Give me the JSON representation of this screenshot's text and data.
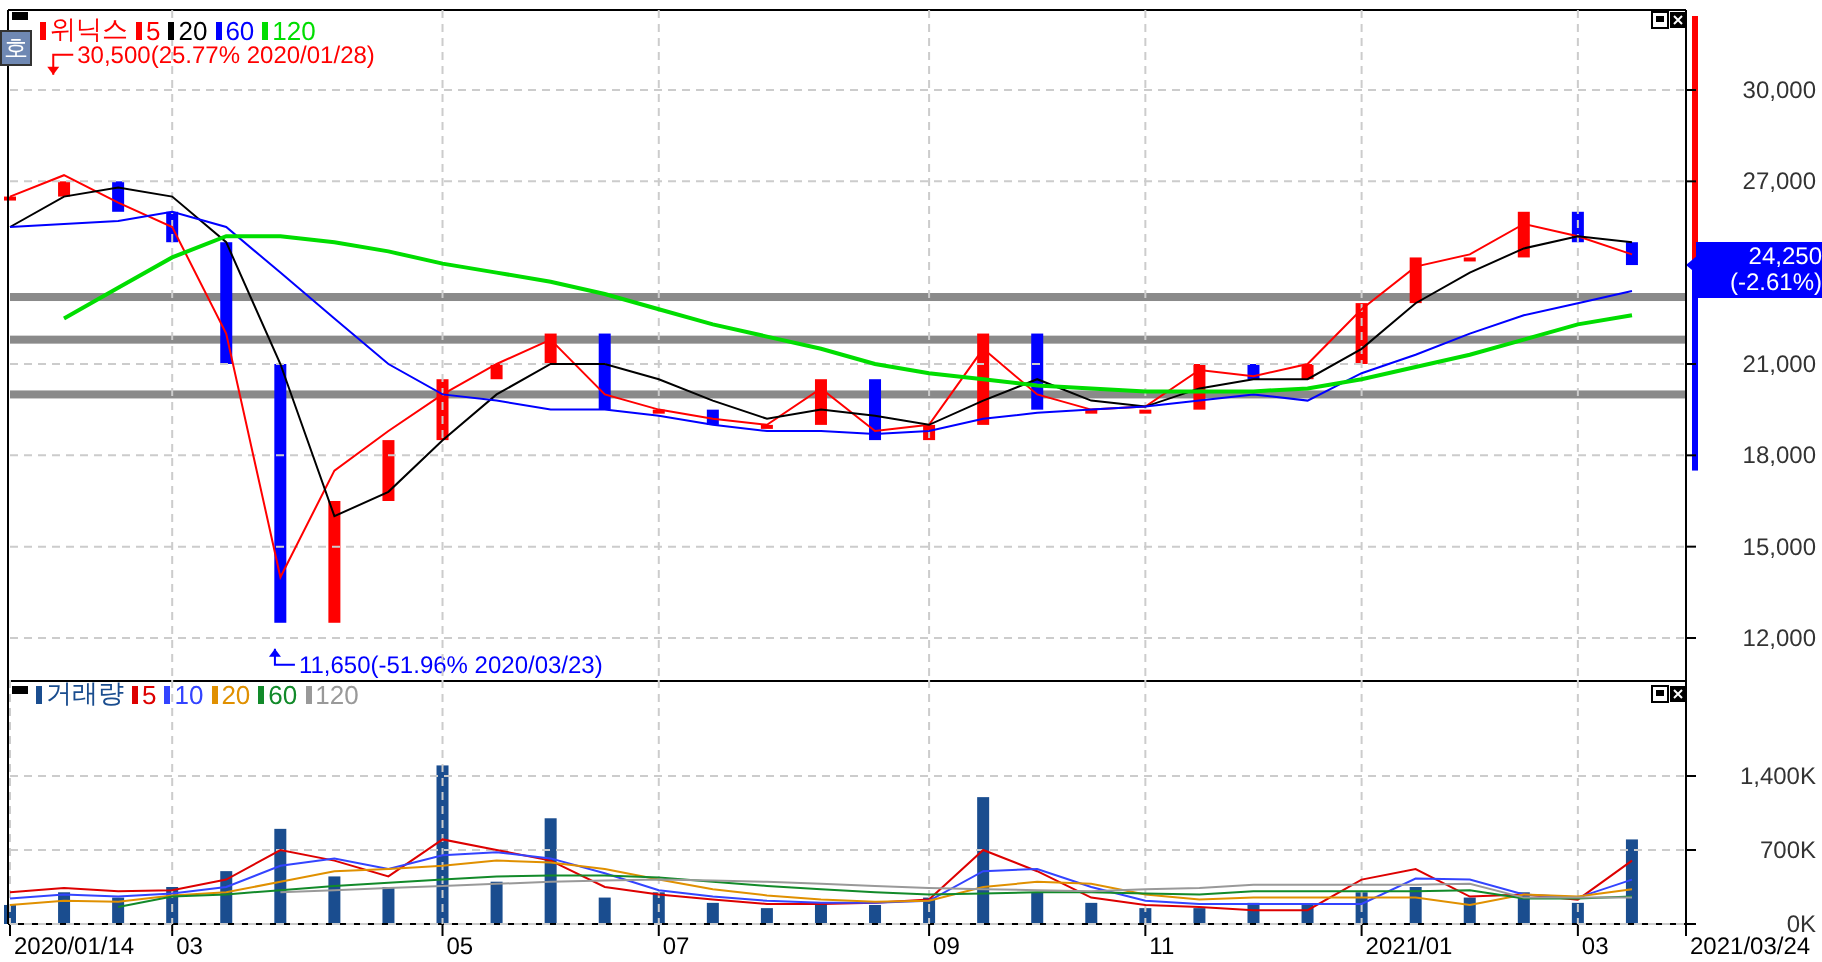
{
  "price_panel": {
    "side_button": "호",
    "chart_data": {
      "type": "line",
      "title": "위닉스",
      "grid": true,
      "series": [
        {
          "name": "5",
          "color": "#ff0000",
          "values": [
            26500,
            27200,
            26300,
            25500,
            22000,
            14000,
            17500,
            18800,
            20000,
            21000,
            21800,
            20000,
            19500,
            19200,
            19000,
            20200,
            18800,
            19000,
            21500,
            20000,
            19500,
            19600,
            20800,
            20600,
            21000,
            22800,
            24200,
            24600,
            25600,
            25200,
            24600
          ]
        },
        {
          "name": "20",
          "color": "#000000",
          "values": [
            25500,
            26500,
            26800,
            26500,
            25000,
            21000,
            16000,
            16800,
            18500,
            20000,
            21000,
            21000,
            20500,
            19800,
            19200,
            19500,
            19300,
            19000,
            19800,
            20500,
            19800,
            19600,
            20200,
            20500,
            20500,
            21500,
            23000,
            24000,
            24800,
            25200,
            25000
          ]
        },
        {
          "name": "60",
          "color": "#0000ff",
          "values": [
            25500,
            25600,
            25700,
            26000,
            25500,
            24000,
            22500,
            21000,
            20000,
            19800,
            19500,
            19500,
            19300,
            19000,
            18800,
            18800,
            18700,
            18800,
            19200,
            19400,
            19500,
            19600,
            19800,
            20000,
            19800,
            20700,
            21300,
            22000,
            22600,
            23000,
            23400
          ]
        },
        {
          "name": "120",
          "color": "#00dd00",
          "values": [
            null,
            22500,
            23500,
            24500,
            25200,
            25200,
            25000,
            24700,
            24300,
            24000,
            23700,
            23300,
            22800,
            22300,
            21900,
            21500,
            21000,
            20700,
            20500,
            20300,
            20200,
            20100,
            20100,
            20100,
            20200,
            20500,
            20900,
            21300,
            21800,
            22300,
            22600
          ]
        }
      ],
      "yticks": [
        {
          "value": 12000,
          "label": "12,000"
        },
        {
          "value": 15000,
          "label": "15,000"
        },
        {
          "value": 18000,
          "label": "18,000"
        },
        {
          "value": 21000,
          "label": "21,000"
        },
        {
          "value": 27000,
          "label": "27,000"
        },
        {
          "value": 30000,
          "label": "30,000"
        }
      ],
      "ylim": [
        10620,
        32628
      ],
      "annotations": [
        "30,500(25.77% 2020/01/28)",
        "11,650(-51.96% 2020/03/23)"
      ]
    },
    "current_price": {
      "price": "24,250",
      "change": "(-2.61%)"
    }
  },
  "volume_panel": {
    "chart_data": {
      "type": "line",
      "title": "거래량",
      "grid": true,
      "series": [
        {
          "name": "5",
          "color": "#dd0000",
          "values": [
            300,
            340,
            310,
            320,
            420,
            700,
            600,
            450,
            800,
            700,
            600,
            350,
            280,
            230,
            190,
            190,
            200,
            230,
            700,
            500,
            250,
            180,
            160,
            130,
            130,
            420,
            520,
            260,
            280,
            230,
            600
          ]
        },
        {
          "name": "10",
          "color": "#3344ff",
          "values": [
            240,
            280,
            260,
            290,
            350,
            550,
            620,
            520,
            650,
            680,
            620,
            480,
            320,
            260,
            220,
            200,
            200,
            220,
            500,
            520,
            350,
            220,
            190,
            190,
            190,
            190,
            430,
            420,
            280,
            250,
            420
          ]
        },
        {
          "name": "20",
          "color": "#e09000",
          "values": [
            180,
            220,
            210,
            270,
            300,
            400,
            500,
            520,
            550,
            600,
            580,
            520,
            420,
            330,
            270,
            230,
            210,
            220,
            350,
            400,
            380,
            280,
            230,
            250,
            250,
            250,
            250,
            180,
            280,
            260,
            330
          ]
        },
        {
          "name": "60",
          "color": "#128a2a",
          "values": [
            null,
            null,
            160,
            260,
            280,
            320,
            360,
            390,
            420,
            450,
            460,
            460,
            440,
            400,
            360,
            330,
            300,
            280,
            290,
            300,
            300,
            290,
            280,
            310,
            310,
            310,
            310,
            320,
            240,
            240,
            260
          ]
        },
        {
          "name": "120",
          "color": "#999999",
          "values": [
            null,
            null,
            null,
            null,
            null,
            300,
            320,
            340,
            360,
            380,
            400,
            410,
            420,
            410,
            400,
            380,
            360,
            340,
            330,
            320,
            310,
            330,
            340,
            370,
            370,
            370,
            370,
            380,
            250,
            250,
            250
          ]
        }
      ],
      "ylim": [
        0,
        2308
      ],
      "yticks": [
        {
          "value": 0,
          "label": "0K"
        },
        {
          "value": 700,
          "label": "700K"
        },
        {
          "value": 1400,
          "label": "1,400K"
        }
      ]
    },
    "date_axis": [
      "2020/01/14",
      "03",
      "05",
      "07",
      "09",
      "11",
      "2021/01",
      "03",
      "2021/03/24"
    ]
  }
}
